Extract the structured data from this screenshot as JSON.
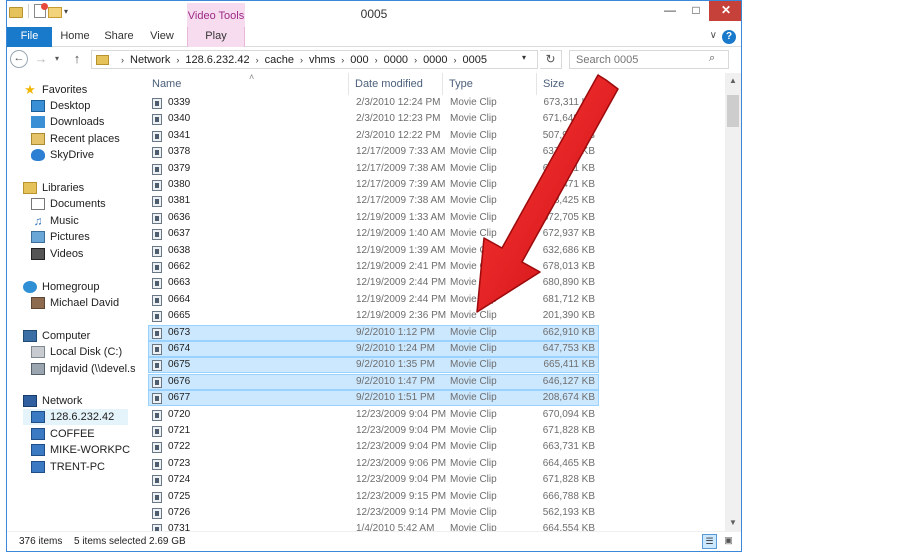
{
  "window": {
    "title": "0005"
  },
  "ribbon": {
    "context_header": "Video Tools",
    "tabs": [
      "File",
      "Home",
      "Share",
      "View",
      "Play"
    ]
  },
  "address": {
    "crumbs": [
      "Network",
      "128.6.232.42",
      "cache",
      "vhms",
      "000",
      "0000",
      "0000",
      "0005"
    ],
    "search_placeholder": "Search 0005"
  },
  "nav": {
    "favorites": {
      "label": "Favorites",
      "items": [
        "Desktop",
        "Downloads",
        "Recent places",
        "SkyDrive"
      ]
    },
    "libraries": {
      "label": "Libraries",
      "items": [
        "Documents",
        "Music",
        "Pictures",
        "Videos"
      ]
    },
    "homegroup": {
      "label": "Homegroup",
      "items": [
        "Michael David"
      ]
    },
    "computer": {
      "label": "Computer",
      "items": [
        "Local Disk (C:)",
        "mjdavid (\\\\devel.sas"
      ]
    },
    "network": {
      "label": "Network",
      "items": [
        "128.6.232.42",
        "COFFEE",
        "MIKE-WORKPC",
        "TRENT-PC"
      ]
    }
  },
  "columns": [
    "Name",
    "Date modified",
    "Type",
    "Size"
  ],
  "files": [
    {
      "name": "0339",
      "date": "2/3/2010 12:24 PM",
      "type": "Movie Clip",
      "size": "673,311 KB",
      "selected": false
    },
    {
      "name": "0340",
      "date": "2/3/2010 12:23 PM",
      "type": "Movie Clip",
      "size": "671,648 KB",
      "selected": false
    },
    {
      "name": "0341",
      "date": "2/3/2010 12:22 PM",
      "type": "Movie Clip",
      "size": "507,996 KB",
      "selected": false
    },
    {
      "name": "0378",
      "date": "12/17/2009 7:33 AM",
      "type": "Movie Clip",
      "size": "637,720 KB",
      "selected": false
    },
    {
      "name": "0379",
      "date": "12/17/2009 7:38 AM",
      "type": "Movie Clip",
      "size": "638,221 KB",
      "selected": false
    },
    {
      "name": "0380",
      "date": "12/17/2009 7:39 AM",
      "type": "Movie Clip",
      "size": "663,471 KB",
      "selected": false
    },
    {
      "name": "0381",
      "date": "12/17/2009 7:38 AM",
      "type": "Movie Clip",
      "size": "648,425 KB",
      "selected": false
    },
    {
      "name": "0636",
      "date": "12/19/2009 1:33 AM",
      "type": "Movie Clip",
      "size": "672,705 KB",
      "selected": false
    },
    {
      "name": "0637",
      "date": "12/19/2009 1:40 AM",
      "type": "Movie Clip",
      "size": "672,937 KB",
      "selected": false
    },
    {
      "name": "0638",
      "date": "12/19/2009 1:39 AM",
      "type": "Movie Clip",
      "size": "632,686 KB",
      "selected": false
    },
    {
      "name": "0662",
      "date": "12/19/2009 2:41 PM",
      "type": "Movie Clip",
      "size": "678,013 KB",
      "selected": false
    },
    {
      "name": "0663",
      "date": "12/19/2009 2:44 PM",
      "type": "Movie Clip",
      "size": "680,890 KB",
      "selected": false
    },
    {
      "name": "0664",
      "date": "12/19/2009 2:44 PM",
      "type": "Movie Clip",
      "size": "681,712 KB",
      "selected": false
    },
    {
      "name": "0665",
      "date": "12/19/2009 2:36 PM",
      "type": "Movie Clip",
      "size": "201,390 KB",
      "selected": false
    },
    {
      "name": "0673",
      "date": "9/2/2010 1:12 PM",
      "type": "Movie Clip",
      "size": "662,910 KB",
      "selected": true
    },
    {
      "name": "0674",
      "date": "9/2/2010 1:24 PM",
      "type": "Movie Clip",
      "size": "647,753 KB",
      "selected": true
    },
    {
      "name": "0675",
      "date": "9/2/2010 1:35 PM",
      "type": "Movie Clip",
      "size": "665,411 KB",
      "selected": true
    },
    {
      "name": "0676",
      "date": "9/2/2010 1:47 PM",
      "type": "Movie Clip",
      "size": "646,127 KB",
      "selected": true
    },
    {
      "name": "0677",
      "date": "9/2/2010 1:51 PM",
      "type": "Movie Clip",
      "size": "208,674 KB",
      "selected": true
    },
    {
      "name": "0720",
      "date": "12/23/2009 9:04 PM",
      "type": "Movie Clip",
      "size": "670,094 KB",
      "selected": false
    },
    {
      "name": "0721",
      "date": "12/23/2009 9:04 PM",
      "type": "Movie Clip",
      "size": "671,828 KB",
      "selected": false
    },
    {
      "name": "0722",
      "date": "12/23/2009 9:04 PM",
      "type": "Movie Clip",
      "size": "663,731 KB",
      "selected": false
    },
    {
      "name": "0723",
      "date": "12/23/2009 9:06 PM",
      "type": "Movie Clip",
      "size": "664,465 KB",
      "selected": false
    },
    {
      "name": "0724",
      "date": "12/23/2009 9:04 PM",
      "type": "Movie Clip",
      "size": "671,828 KB",
      "selected": false
    },
    {
      "name": "0725",
      "date": "12/23/2009 9:15 PM",
      "type": "Movie Clip",
      "size": "666,788 KB",
      "selected": false
    },
    {
      "name": "0726",
      "date": "12/23/2009 9:14 PM",
      "type": "Movie Clip",
      "size": "562,193 KB",
      "selected": false
    },
    {
      "name": "0731",
      "date": "1/4/2010 5:42 AM",
      "type": "Movie Clip",
      "size": "664,554 KB",
      "selected": false
    }
  ],
  "status": {
    "count": "376 items",
    "selected": "5 items selected  2.69 GB"
  },
  "icons": {
    "back": "←",
    "forward": "→",
    "recent": "▾",
    "up": "↑",
    "crumb_separator": "›",
    "addr_drop": "▾",
    "refresh": "↻",
    "search": "⌕",
    "minimize": "—",
    "maximize": "□",
    "close": "✕",
    "ribbon_expand": "∨",
    "help": "?",
    "favorites_star": "★",
    "music_note": "♫",
    "sort": "˄",
    "scroll_up": "▲",
    "scroll_down": "▼",
    "qat_drop": "▾",
    "view_details": "☰",
    "view_thumbs": "▣"
  },
  "colors": {
    "accent": "#1979ca",
    "context_tab": "#f7dcf0",
    "selection_fill": "#cce8ff",
    "selection_border": "#99d1ff",
    "close_button": "#c7413b",
    "annotation_arrow": "#e0151a"
  }
}
